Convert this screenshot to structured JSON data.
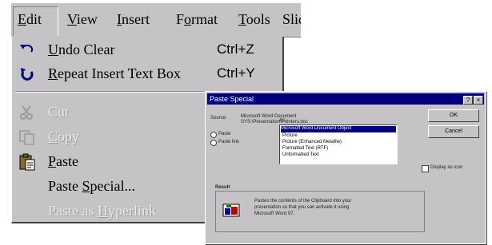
{
  "menubar": {
    "items": [
      {
        "accel": "E",
        "rest": "dit"
      },
      {
        "accel": "V",
        "rest": "iew"
      },
      {
        "accel": "I",
        "rest": "nsert"
      },
      {
        "pre": "F",
        "accel": "o",
        "rest": "rmat"
      },
      {
        "accel": "T",
        "rest": "ools"
      },
      {
        "pre": "Slid",
        "accel": "",
        "rest": ""
      }
    ]
  },
  "edit_menu": {
    "undo": {
      "accel": "U",
      "rest": "ndo Clear",
      "shortcut": "Ctrl+Z",
      "icon": "undo-icon"
    },
    "repeat": {
      "accel": "R",
      "rest": "epeat Insert Text Box",
      "shortcut": "Ctrl+Y",
      "icon": "repeat-icon"
    },
    "cut": {
      "accel": "",
      "rest": "Cut",
      "icon": "scissors-icon"
    },
    "copy": {
      "accel": "C",
      "rest": "opy",
      "icon": "copy-icon"
    },
    "paste": {
      "accel": "P",
      "rest": "aste",
      "icon": "clipboard-icon"
    },
    "paste_special": {
      "pre": "Paste ",
      "accel": "S",
      "rest": "pecial..."
    },
    "paste_hyperlink": {
      "pre": "Paste as ",
      "accel": "H",
      "rest": "yperlink"
    }
  },
  "dialog": {
    "title": "Paste Special",
    "source_label": "Source:",
    "source_line1": "Microsoft Word Document",
    "source_line2": "SYS:\\Presentation\\Pointers.doc",
    "as_label": "As:",
    "paste_option": "Paste",
    "paste_link_option": "Paste link",
    "list_items": [
      "Microsoft Word Document Object",
      "Picture",
      "Picture (Enhanced Metafile)",
      "Formatted Text (RTF)",
      "Unformatted Text"
    ],
    "ok_label": "OK",
    "cancel_label": "Cancel",
    "display_as_icon": "Display as icon",
    "result_label": "Result",
    "result_text_1": "Pastes the contents of the Clipboard into your",
    "result_text_2": "presentation so that you can activate it using",
    "result_text_3": "Microsoft Word 97."
  }
}
